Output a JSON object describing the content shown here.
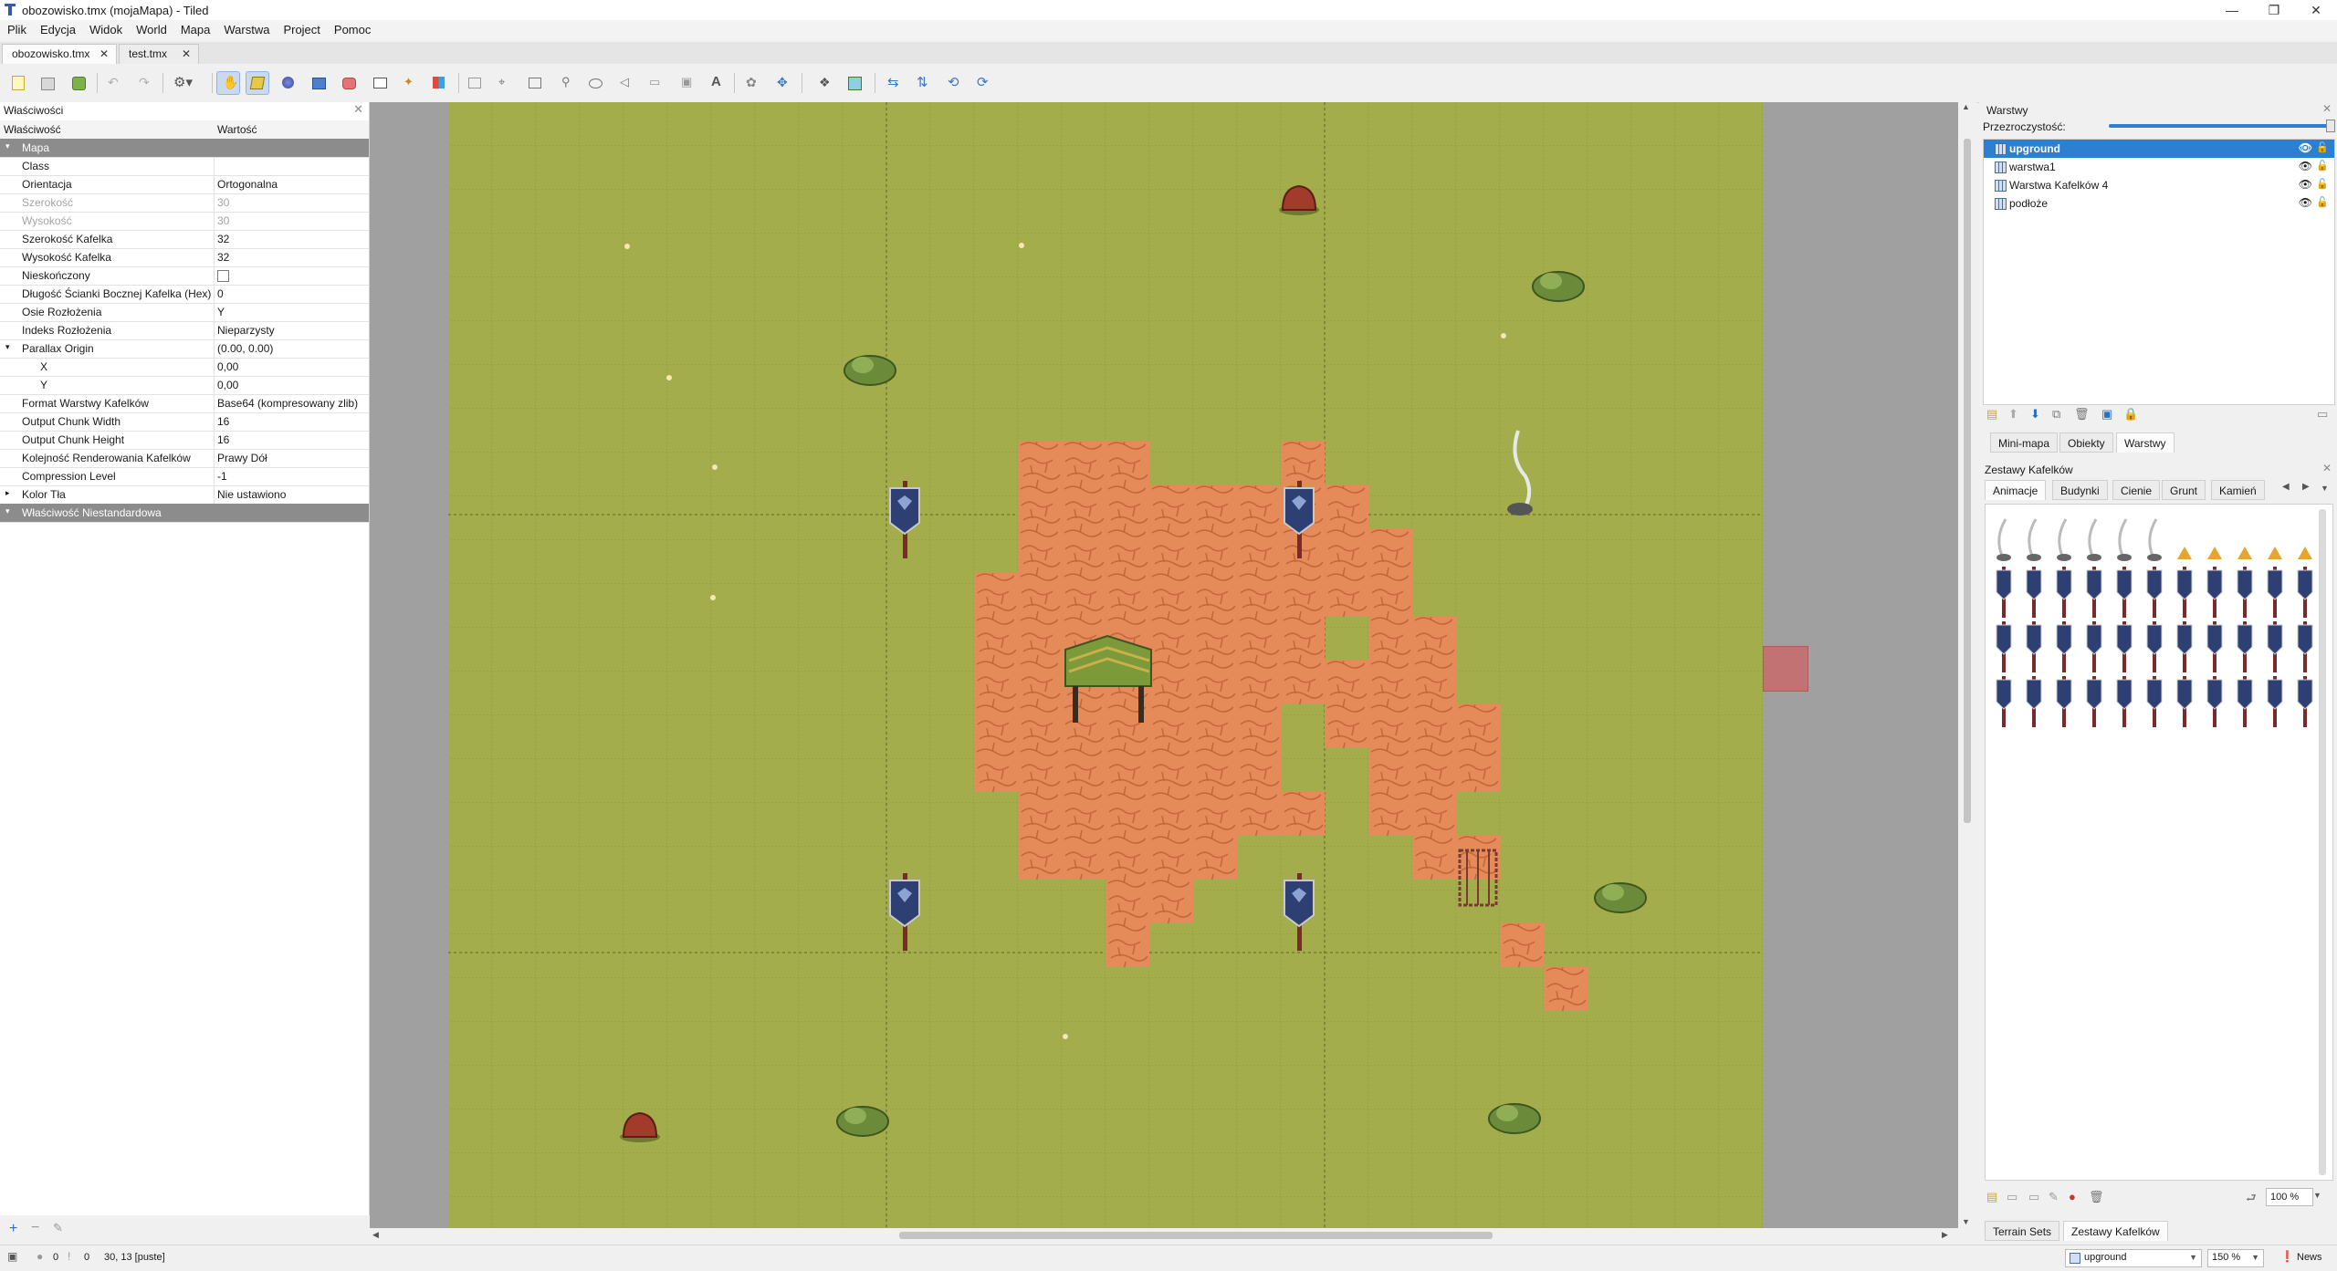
{
  "window": {
    "title": "obozowisko.tmx (mojaMapa) - Tiled",
    "controls": [
      "—",
      "❐",
      "✕"
    ]
  },
  "menubar": [
    "Plik",
    "Edycja",
    "Widok",
    "World",
    "Mapa",
    "Warstwa",
    "Project",
    "Pomoc"
  ],
  "tabs": [
    {
      "label": "obozowisko.tmx",
      "active": true
    },
    {
      "label": "test.tmx",
      "active": false
    }
  ],
  "toolbar": {
    "icons": [
      "new-file-icon",
      "open-icon",
      "save-icon",
      "undo-icon",
      "redo-icon",
      "command-icon",
      "move-hand-icon",
      "stamp-brush-icon",
      "terrain-brush-icon",
      "bucket-fill-icon",
      "shape-fill-icon",
      "eraser-icon",
      "rect-select-icon",
      "magic-wand-icon",
      "select-same-tile-icon",
      "insert-image-icon",
      "edit-polygon-icon",
      "insert-rectangle-icon",
      "insert-point-icon",
      "insert-ellipse-icon",
      "insert-polygon-icon",
      "insert-tile-icon",
      "insert-template-icon",
      "insert-text-icon",
      "world-tool-icon",
      "random-mode-icon",
      "wangfill-icon",
      "highlight-layer-icon",
      "flip-horizontal-icon",
      "flip-vertical-icon",
      "rotate-left-icon",
      "rotate-right-icon"
    ],
    "active_tools": [
      "move-hand-icon",
      "stamp-brush-icon"
    ]
  },
  "properties": {
    "title": "Właściwości",
    "close": "✕",
    "header": {
      "name": "Właściwość",
      "value": "Wartość"
    },
    "rows": [
      {
        "name": "Mapa",
        "value": "",
        "group": true,
        "arrow": "▾"
      },
      {
        "name": "Class",
        "value": ""
      },
      {
        "name": "Orientacja",
        "value": "Ortogonalna"
      },
      {
        "name": "Szerokość",
        "value": "30",
        "dim": true
      },
      {
        "name": "Wysokość",
        "value": "30",
        "dim": true
      },
      {
        "name": "Szerokość Kafelka",
        "value": "32"
      },
      {
        "name": "Wysokość Kafelka",
        "value": "32"
      },
      {
        "name": "Nieskończony",
        "value": "",
        "checkbox": true
      },
      {
        "name": "Długość Ścianki Bocznej Kafelka (Hex)",
        "value": "0"
      },
      {
        "name": "Osie Rozłożenia",
        "value": "Y"
      },
      {
        "name": "Indeks Rozłożenia",
        "value": "Nieparzysty"
      },
      {
        "name": "Parallax Origin",
        "value": "(0.00, 0.00)",
        "arrow": "▾"
      },
      {
        "name": "X",
        "value": "0,00",
        "indent": true
      },
      {
        "name": "Y",
        "value": "0,00",
        "indent": true
      },
      {
        "name": "Format Warstwy Kafelków",
        "value": "Base64 (kompresowany zlib)"
      },
      {
        "name": "Output Chunk Width",
        "value": "16"
      },
      {
        "name": "Output Chunk Height",
        "value": "16"
      },
      {
        "name": "Kolejność Renderowania Kafelków",
        "value": "Prawy Dół"
      },
      {
        "name": "Compression Level",
        "value": "-1"
      },
      {
        "name": "Kolor Tła",
        "value": "Nie ustawiono",
        "arrow": "▸"
      },
      {
        "name": "Właściwość Niestandardowa",
        "value": "",
        "group": true,
        "arrow": "▾"
      }
    ]
  },
  "layers_panel": {
    "title": "Warstwy",
    "opacity_label": "Przezroczystość:",
    "layers": [
      {
        "name": "upground",
        "selected": true
      },
      {
        "name": "warstwa1",
        "selected": false
      },
      {
        "name": "Warstwa Kafelków 4",
        "selected": false
      },
      {
        "name": "podłoże",
        "selected": false
      }
    ],
    "bottom_tabs": [
      "Mini-mapa",
      "Obiekty",
      "Warstwy"
    ],
    "active_bottom_tab": "Warstwy"
  },
  "tilesets_panel": {
    "title": "Zestawy Kafelków",
    "tabs": [
      "Animacje",
      "Budynki",
      "Cienie",
      "Grunt",
      "Kamień"
    ],
    "active_tab": "Animacje",
    "zoom": "100 %",
    "bottom_tabs": [
      "Terrain Sets",
      "Zestawy Kafelków"
    ],
    "active_bottom_tab": "Zestawy Kafelków"
  },
  "statusbar": {
    "errors": "0",
    "warnings": "0",
    "position": "30, 13 [puste]",
    "layer": "upground",
    "zoom": "150 %",
    "news": "News"
  },
  "colors": {
    "grass": "#a4ad4c",
    "dirt": "#e58b59",
    "selection": "#2f7fd1",
    "banner_blue": "#2e3f73"
  }
}
